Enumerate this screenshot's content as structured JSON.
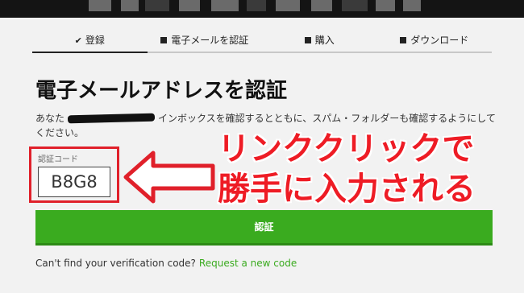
{
  "steps": [
    {
      "icon": "checkmark-icon",
      "label": "登録",
      "active": true
    },
    {
      "icon": "square-icon",
      "label": "電子メールを認証",
      "active": false
    },
    {
      "icon": "square-icon",
      "label": "購入",
      "active": false
    },
    {
      "icon": "square-icon",
      "label": "ダウンロード",
      "active": false
    }
  ],
  "page": {
    "title": "電子メールアドレスを認証",
    "desc_prefix": "あなた",
    "desc_suffix": "インボックスを確認するとともに、スパム・フォルダーも確認するようにしてください。"
  },
  "code": {
    "label": "認証コード",
    "value": "B8G8"
  },
  "annotation": {
    "line1": "リンククリックで",
    "line2": "勝手に入力される"
  },
  "verify_button": {
    "label": "認証"
  },
  "footer": {
    "question": "Can't find your verification code?",
    "link": "Request a new code"
  },
  "colors": {
    "accent_green": "#3aab1f",
    "annotation_red": "#ee1c25"
  }
}
